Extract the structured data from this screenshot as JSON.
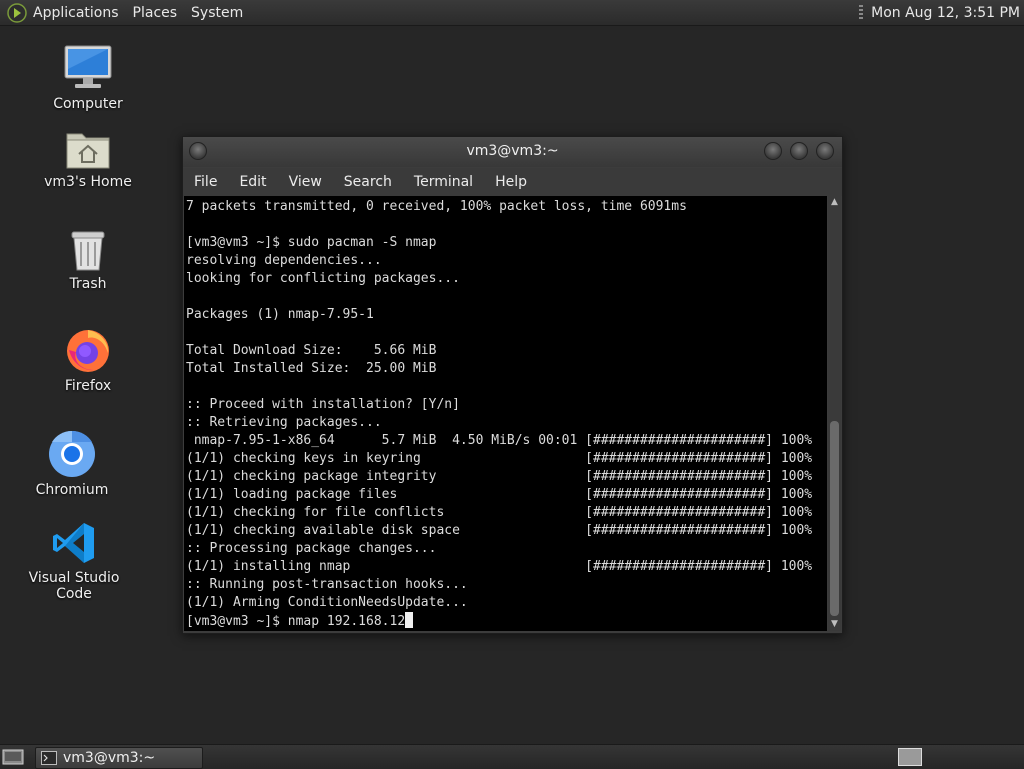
{
  "top_panel": {
    "menus": [
      "Applications",
      "Places",
      "System"
    ],
    "clock": "Mon Aug 12,  3:51 PM"
  },
  "desktop_icons": [
    {
      "label": "Computer",
      "icon": "computer-icon"
    },
    {
      "label": "vm3's Home",
      "icon": "home-folder-icon"
    },
    {
      "label": "Trash",
      "icon": "trash-icon"
    },
    {
      "label": "Firefox",
      "icon": "firefox-icon"
    },
    {
      "label": "Chromium",
      "icon": "chromium-icon"
    },
    {
      "label": "Visual Studio Code",
      "icon": "vscode-icon"
    }
  ],
  "terminal": {
    "title": "vm3@vm3:~",
    "menu": [
      "File",
      "Edit",
      "View",
      "Search",
      "Terminal",
      "Help"
    ],
    "output": "7 packets transmitted, 0 received, 100% packet loss, time 6091ms\n\n[vm3@vm3 ~]$ sudo pacman -S nmap\nresolving dependencies...\nlooking for conflicting packages...\n\nPackages (1) nmap-7.95-1\n\nTotal Download Size:    5.66 MiB\nTotal Installed Size:  25.00 MiB\n\n:: Proceed with installation? [Y/n]\n:: Retrieving packages...\n nmap-7.95-1-x86_64      5.7 MiB  4.50 MiB/s 00:01 [######################] 100%\n(1/1) checking keys in keyring                     [######################] 100%\n(1/1) checking package integrity                   [######################] 100%\n(1/1) loading package files                        [######################] 100%\n(1/1) checking for file conflicts                  [######################] 100%\n(1/1) checking available disk space                [######################] 100%\n:: Processing package changes...\n(1/1) installing nmap                              [######################] 100%\n:: Running post-transaction hooks...\n(1/1) Arming ConditionNeedsUpdate...\n[vm3@vm3 ~]$ nmap 192.168.12"
  },
  "taskbar": {
    "window_title": "vm3@vm3:~"
  }
}
